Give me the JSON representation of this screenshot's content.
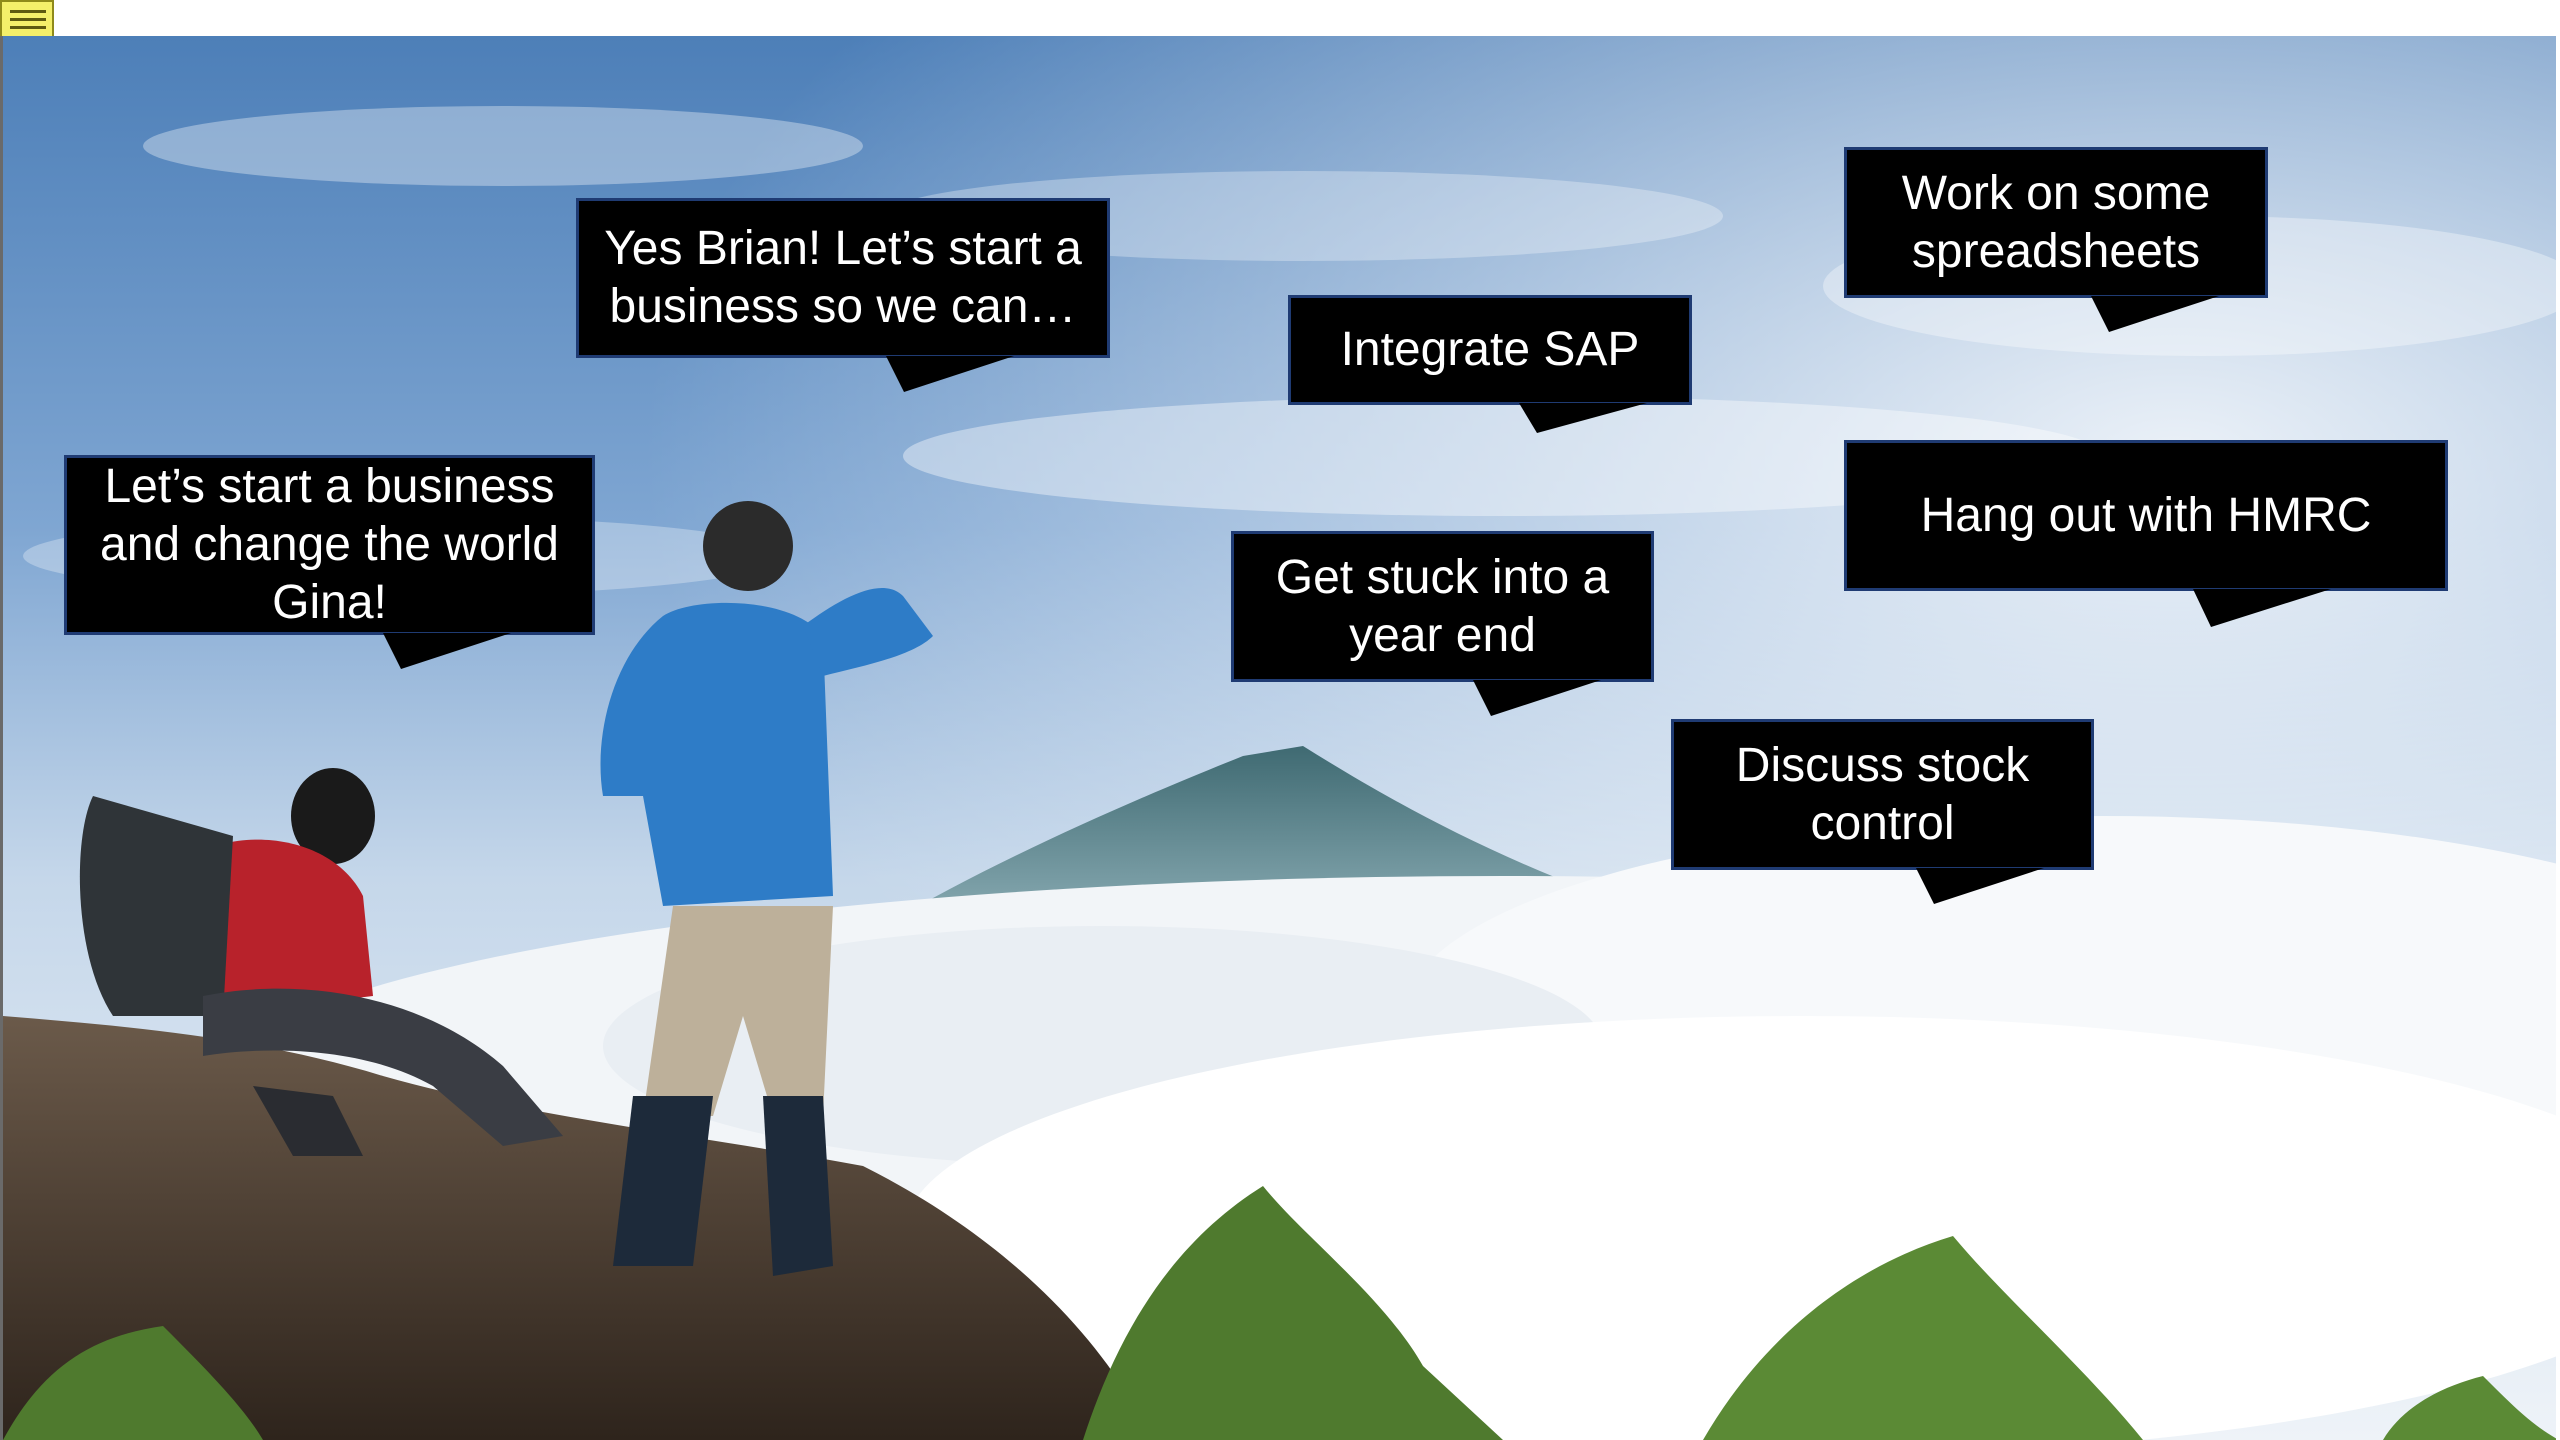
{
  "note": {
    "icon": "sticky-note-icon"
  },
  "bubbles": {
    "lets_start": "Let’s start a business\nand change the world\nGina!",
    "yes_brian": "Yes Brian! Let’s start a\nbusiness so we can…",
    "integrate_sap": "Integrate SAP",
    "spreadsheets": "Work on some\nspreadsheets",
    "hmrc": "Hang out with HMRC",
    "year_end": "Get stuck into a\nyear end",
    "stock": "Discuss stock\ncontrol"
  },
  "colors": {
    "bubble_fill": "#000000",
    "bubble_border": "#1f3b73",
    "bubble_text": "#ffffff"
  }
}
